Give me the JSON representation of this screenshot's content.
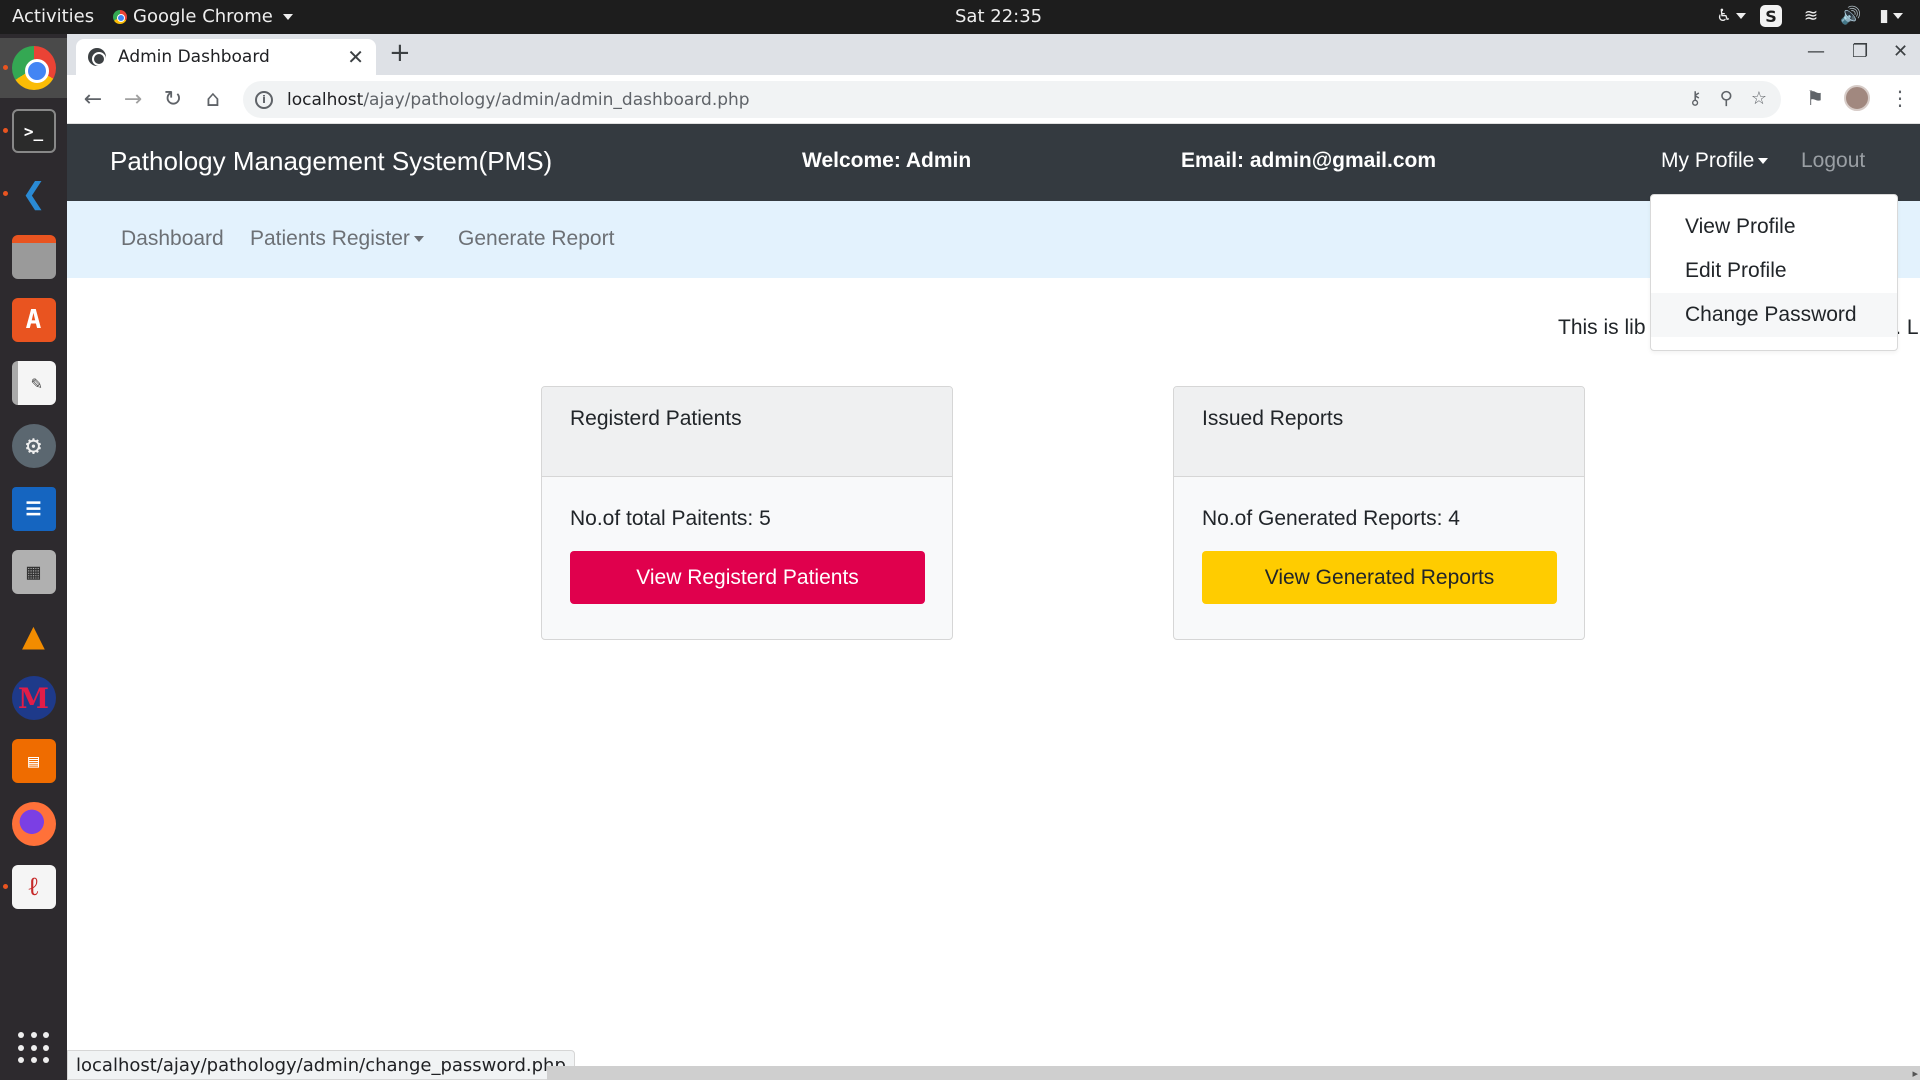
{
  "system": {
    "activities": "Activities",
    "app_name": "Google Chrome",
    "clock": "Sat 22:35",
    "tray": {
      "accessibility": "accessibility-icon",
      "skype": "S",
      "wifi": "wifi-icon",
      "volume": "volume-icon",
      "battery": "battery-icon"
    }
  },
  "dock": {
    "items": [
      "chrome",
      "terminal",
      "vscode",
      "files",
      "software-center",
      "text-editor",
      "settings",
      "writer",
      "calculator",
      "vlc",
      "m-app",
      "impress",
      "firefox",
      "draw"
    ]
  },
  "browser": {
    "tab_title": "Admin Dashboard",
    "url_host": "localhost",
    "url_path": "/ajay/pathology/admin/admin_dashboard.php",
    "status_url": "localhost/ajay/pathology/admin/change_password.php"
  },
  "page": {
    "brand": "Pathology Management System(PMS)",
    "welcome": "Welcome: Admin",
    "email": "Email: admin@gmail.com",
    "my_profile": "My Profile",
    "logout": "Logout",
    "nav": {
      "dashboard": "Dashboard",
      "patients_register": "Patients Register",
      "generate_report": "Generate Report"
    },
    "marquee_left": "This is lib",
    "marquee_right": "n. L",
    "dropdown": [
      "View Profile",
      "Edit Profile",
      "Change Password"
    ],
    "cards": [
      {
        "header": "Registerd Patients",
        "text": "No.of total Paitents: 5",
        "button": "View Registerd Patients"
      },
      {
        "header": "Issued Reports",
        "text": "No.of Generated Reports: 4",
        "button": "View Generated Reports"
      }
    ]
  },
  "colors": {
    "navbar_dark": "#343a40",
    "navbar_light": "#e3f2fd",
    "danger": "#e0004d",
    "warning": "#ffcc00"
  }
}
